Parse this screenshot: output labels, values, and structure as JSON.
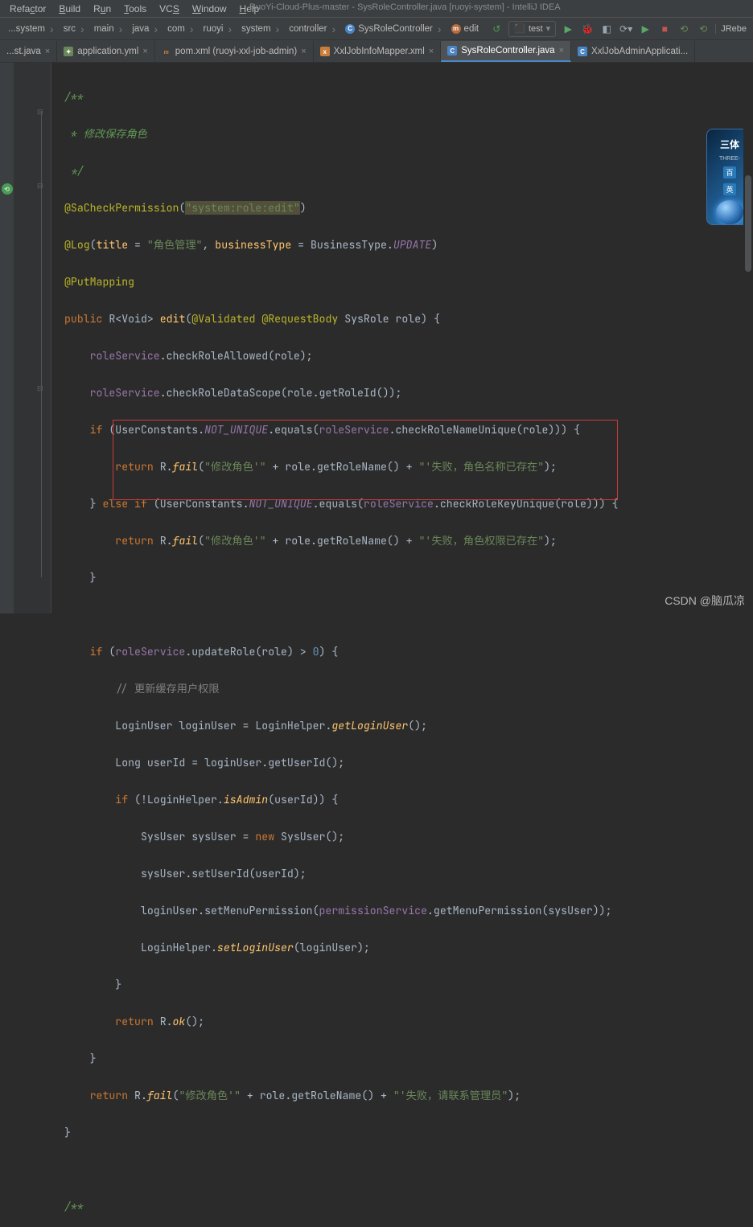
{
  "window": {
    "title": "RuoYi-Cloud-Plus-master - SysRoleController.java [ruoyi-system] - IntelliJ IDEA"
  },
  "menu": {
    "refactor": "Refactor",
    "build": "Build",
    "run": "Run",
    "tools": "Tools",
    "vcs": "VCS",
    "window": "Window",
    "help": "Help"
  },
  "breadcrumb": {
    "c0": "...system",
    "c1": "src",
    "c2": "main",
    "c3": "java",
    "c4": "com",
    "c5": "ruoyi",
    "c6": "system",
    "c7": "controller",
    "c8": "SysRoleController",
    "c9": "edit"
  },
  "runconfig": {
    "name": "test",
    "play": "▶",
    "bug": "🐞"
  },
  "tabs": {
    "t0": "...st.java",
    "t1": "application.yml",
    "t2": "pom.xml (ruoyi-xxl-job-admin)",
    "t3": "XxlJobInfoMapper.xml",
    "t4": "SysRoleController.java",
    "t5": "XxlJobAdminApplicati..."
  },
  "code": {
    "l01": "/**",
    "l02": " * 修改保存角色",
    "l03": " */",
    "l04a": "@SaCheckPermission",
    "l04b": "(",
    "l04c": "\"system:role:edit\"",
    "l04d": ")",
    "l05a": "@Log",
    "l05b": "(",
    "l05c": "title",
    "l05d": " = ",
    "l05e": "\"角色管理\"",
    "l05f": ", ",
    "l05g": "businessType",
    "l05h": " = BusinessType.",
    "l05i": "UPDATE",
    "l05j": ")",
    "l06a": "@PutMapping",
    "l07a": "public ",
    "l07b": "R<",
    "l07c": "Void",
    "l07d": "> ",
    "l07e": "edit",
    "l07f": "(",
    "l07g": "@Validated @RequestBody ",
    "l07h": "SysRole role) {",
    "l08a": "    roleService",
    "l08b": ".checkRoleAllowed(role);",
    "l09a": "    roleService",
    "l09b": ".checkRoleDataScope(role.getRoleId());",
    "l10a": "    if ",
    "l10b": "(UserConstants.",
    "l10c": "NOT_UNIQUE",
    "l10d": ".equals(",
    "l10e": "roleService",
    "l10f": ".checkRoleNameUnique(role))) {",
    "l11a": "        return ",
    "l11b": "R.",
    "l11c": "fail",
    "l11d": "(",
    "l11e": "\"修改角色'\"",
    "l11f": " + role.getRoleName() + ",
    "l11g": "\"'失败，角色名称已存在\"",
    "l11h": ");",
    "l12a": "    } ",
    "l12b": "else if ",
    "l12c": "(UserConstants.",
    "l12d": "NOT_UNIQUE",
    "l12e": ".equals(",
    "l12f": "roleService",
    "l12g": ".checkRoleKeyUnique(role))) {",
    "l13a": "        return ",
    "l13b": "R.",
    "l13c": "fail",
    "l13d": "(",
    "l13e": "\"修改角色'\"",
    "l13f": " + role.getRoleName() + ",
    "l13g": "\"'失败，角色权限已存在\"",
    "l13h": ");",
    "l14": "    }",
    "l15": "",
    "l16a": "    if ",
    "l16b": "(",
    "l16c": "roleService",
    "l16d": ".updateRole(role) > ",
    "l16e": "0",
    "l16f": ") {",
    "l17a": "        // 更新缓存用户权限",
    "l18a": "        LoginUser loginUser = LoginHelper.",
    "l18b": "getLoginUser",
    "l18c": "();",
    "l19a": "        Long userId = loginUser.getUserId();",
    "l20a": "        if ",
    "l20b": "(!LoginHelper.",
    "l20c": "isAdmin",
    "l20d": "(userId)) {",
    "l21a": "            SysUser sysUser = ",
    "l21b": "new ",
    "l21c": "SysUser();",
    "l22a": "            sysUser.setUserId(userId);",
    "l23a": "            loginUser.setMenuPermission(",
    "l23b": "permissionService",
    "l23c": ".getMenuPermission(sysUser));",
    "l24a": "            LoginHelper.",
    "l24b": "setLoginUser",
    "l24c": "(loginUser);",
    "l25": "        }",
    "l26a": "        return ",
    "l26b": "R.",
    "l26c": "ok",
    "l26d": "();",
    "l27": "    }",
    "l28a": "    return ",
    "l28b": "R.",
    "l28c": "fail",
    "l28d": "(",
    "l28e": "\"修改角色'\"",
    "l28f": " + role.getRoleName() + ",
    "l28g": "\"'失败，请联系管理员\"",
    "l28h": ");",
    "l29": "}",
    "l30": "",
    "l31": "/**"
  },
  "sidewidget": {
    "title": "三体",
    "sub": "THREE-",
    "badge1": "百",
    "badge2": "英"
  },
  "watermark": "CSDN @脑瓜凉"
}
